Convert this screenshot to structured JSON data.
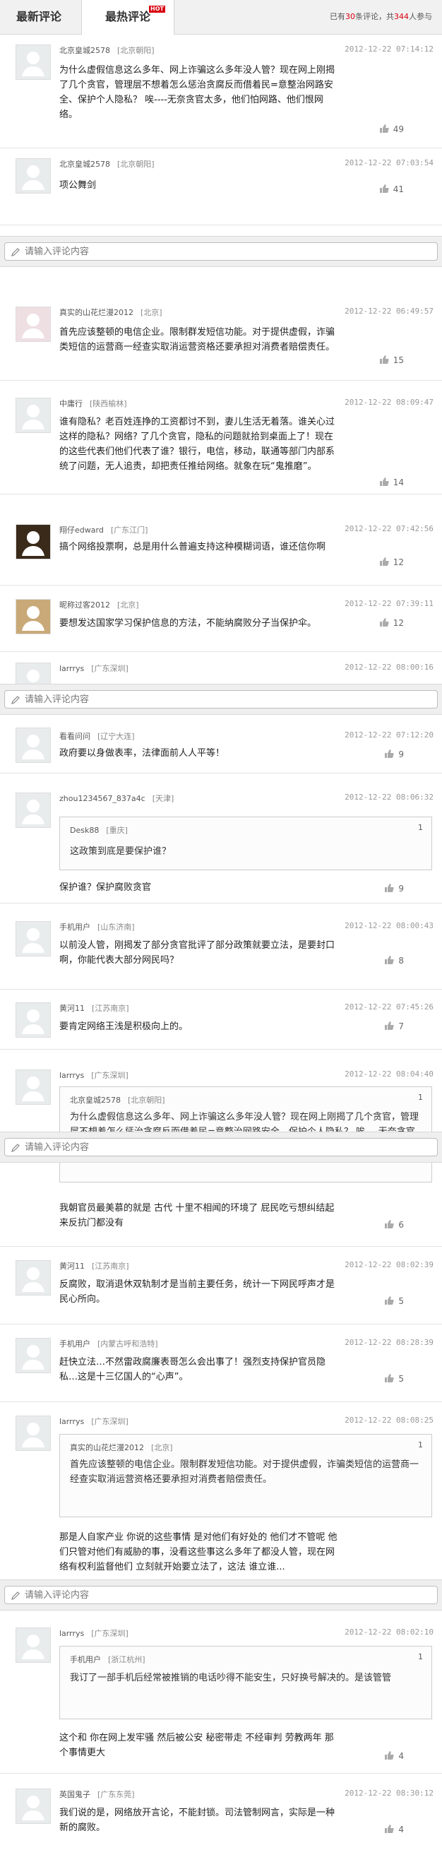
{
  "tabs": {
    "latest": "最新评论",
    "hottest": "最热评论",
    "hot_badge": "HOT"
  },
  "summary": {
    "prefix": "已有",
    "comments": "30",
    "middle": "条评论，共",
    "people": "344",
    "suffix": "人参与"
  },
  "input": {
    "placeholder": "请输入评论内容"
  },
  "comments": [
    {
      "user": "北京皇城2578",
      "loc": "[北京朝阳]",
      "time": "2012-12-22 07:14:12",
      "text": "为什么虚假信息这么多年、网上诈骗这么多年没人管？现在网上刚揭了几个贪官，管理层不想着怎么惩治贪腐反而借着民=意整治网路安全、保护个人隐私？ 唉----无奈贪官太多，他们怕网路、他们恨网络。",
      "likes": "49"
    },
    {
      "user": "北京皇城2578",
      "loc": "[北京朝阳]",
      "time": "2012-12-22 07:03:54",
      "text": "项公舞剑",
      "likes": "41"
    },
    {
      "user": "真实的山花烂漫2012",
      "loc": "[北京]",
      "time": "2012-12-22 06:49:57",
      "text": "首先应该整顿的电信企业。限制群发短信功能。对于提供虚假，诈骗类短信的运营商一经查实取消运营资格还要承担对消费者赔偿责任。",
      "likes": "15"
    },
    {
      "user": "中庸行",
      "loc": "[陕西榆林]",
      "time": "2012-12-22 08:09:47",
      "text": "谁有隐私？老百姓连挣的工资都讨不到，妻儿生活无着落。谁关心过这样的隐私？网络? 了几个贪官，隐私的问题就拾到桌面上了！现在的这些代表们他们代表了谁？银行，电信，移动，联通等部门内部系统了问题，无人追责，却把责任推给网络。就象在玩“鬼推磨”。",
      "likes": "14"
    },
    {
      "user": "翔仔edward",
      "loc": "[广东江门]",
      "time": "2012-12-22 07:42:56",
      "text": "搞个网络投票啊，总是用什么普遍支持这种模糊词语，谁还信你啊",
      "likes": "12"
    },
    {
      "user": "昵称过客2012",
      "loc": "[北京]",
      "time": "2012-12-22 07:39:11",
      "text": "要想发达国家学习保护信息的方法，不能纳腐败分子当保护伞。",
      "likes": "12"
    },
    {
      "user": "larrrys",
      "loc": "[广东深圳]",
      "time": "2012-12-22 08:00:16"
    },
    {
      "user": "看看问问",
      "loc": "[辽宁大连]",
      "time": "2012-12-22 07:12:20",
      "text": "政府要以身做表率，法律面前人人平等！",
      "likes": "9"
    },
    {
      "user": "zhou1234567_837a4c",
      "loc": "[天津]",
      "time": "2012-12-22 08:06:32",
      "quote": {
        "user": "Desk88",
        "loc": "[重庆]",
        "num": "1",
        "text": "这政策到底是要保护谁？"
      },
      "text": "保护谁？保护腐败贪官",
      "likes": "9"
    },
    {
      "user": "手机用户",
      "loc": "[山东济南]",
      "time": "2012-12-22 08:00:43",
      "text": "以前没人管，刚揭发了部分贪官批评了部分政策就要立法，是要封口啊，你能代表大部分网民吗？",
      "likes": "8"
    },
    {
      "user": "黄河11",
      "loc": "[江苏南京]",
      "time": "2012-12-22 07:45:26",
      "text": "要肯定网络王浅是积极向上的。",
      "likes": "7"
    },
    {
      "user": "larrrys",
      "loc": "[广东深圳]",
      "time": "2012-12-22 08:04:40",
      "quote": {
        "user": "北京皇城2578",
        "loc": "[北京朝阳]",
        "num": "1",
        "text": "为什么虚假信息这么多年、网上诈骗这么多年没人管？现在网上刚揭了几个贪官，管理层不想着怎么惩治贪腐反而借着民=意整治网路安全、保护个人隐私？ 唉----无奈贪官太多，他们怕网路、他们恨网络。"
      },
      "text": "我朝官员最美慕的就是 古代 十里不相闻的环境了 屁民吃亏想纠结起来反抗门都没有",
      "likes": "6"
    },
    {
      "user": "黄河11",
      "loc": "[江苏南京]",
      "time": "2012-12-22 08:02:39",
      "text": "反腐败，取消退休双轨制才是当前主要任务，统计一下网民呼声才是民心所向。",
      "likes": "5"
    },
    {
      "user": "手机用户",
      "loc": "[内蒙古呼和浩特]",
      "time": "2012-12-22 08:28:39",
      "text": "赶快立法…不然雷政腐廉表哥怎么会出事了！强烈支持保护官员隐私…这是十三亿国人的“心声”。",
      "likes": "5"
    },
    {
      "user": "larrrys",
      "loc": "[广东深圳]",
      "time": "2012-12-22 08:08:25",
      "quote": {
        "user": "真实的山花烂漫2012",
        "loc": "[北京]",
        "num": "1",
        "text": "首先应该整顿的电信企业。限制群发短信功能。对于提供虚假，诈骗类短信的运营商一经查实取消运营资格还要承担对消费者赔偿责任。"
      },
      "text": "那是人自家产业 你说的这些事情 是对他们有好处的 他们才不管呢 他们只管对他们有威胁的事，没看这些事这么多年了都没人管，现在网络有权利监督他们 立刻就开始要立法了，这法 谁立谁...",
      "likes": ""
    },
    {
      "user": "larrrys",
      "loc": "[广东深圳]",
      "time": "2012-12-22 08:02:10",
      "quote": {
        "user": "手机用户",
        "loc": "[浙江杭州]",
        "num": "1",
        "text": "我订了一部手机后经常被推销的电话吵得不能安生，只好换号解决的。是该管管"
      },
      "text": "这个和 你在网上发牢骚 然后被公安 秘密带走 不经审判 劳教两年 那个事情更大",
      "likes": "4"
    },
    {
      "user": "英国鬼子",
      "loc": "[广东东莞]",
      "time": "2012-12-22 08:30:12",
      "text": "我们说的是，网络放开言论，不能封锁。司法管制网言，实际是一种新的腐败。",
      "likes": "4"
    }
  ]
}
